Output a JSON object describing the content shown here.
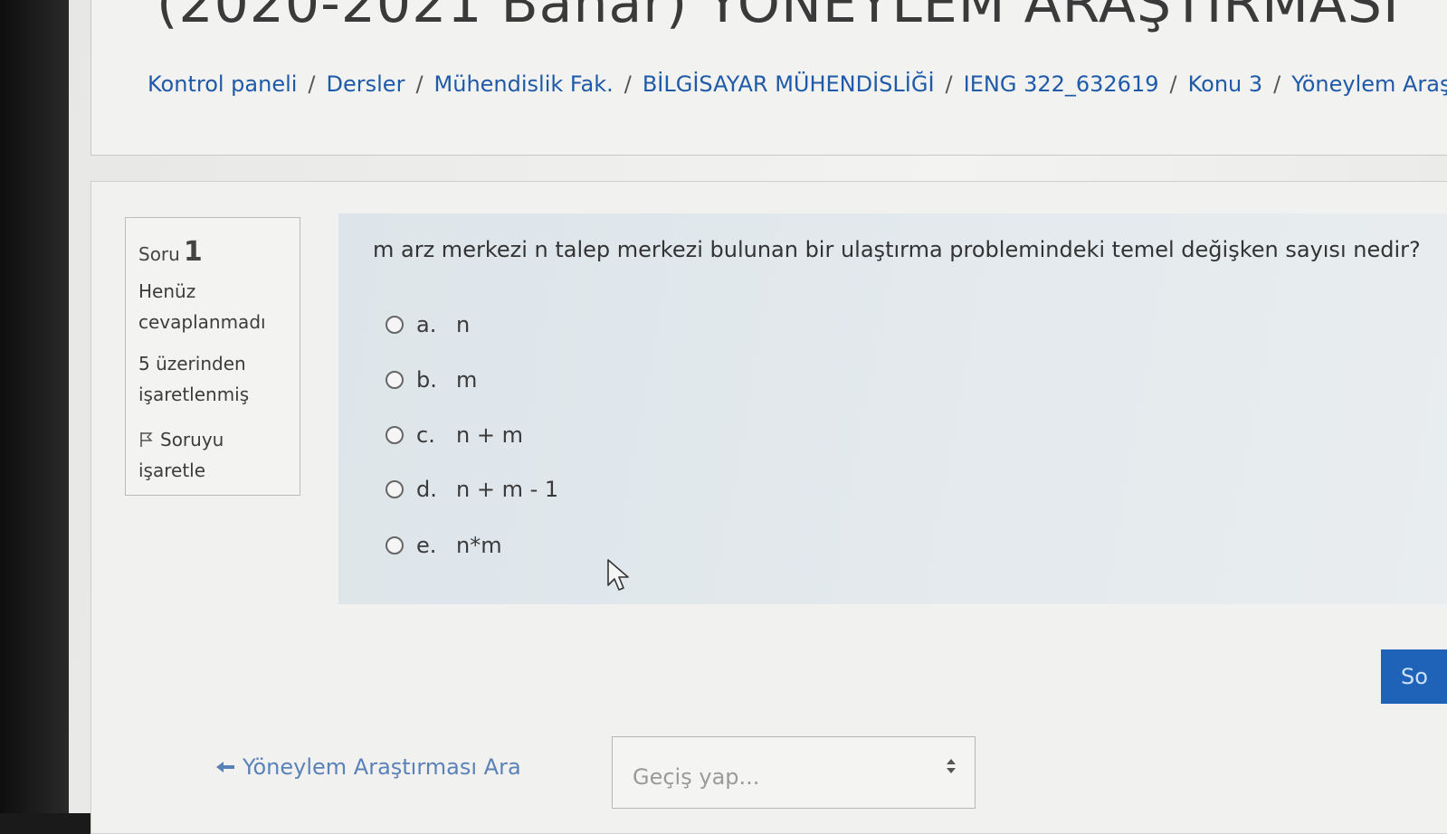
{
  "header": {
    "title": "(2020-2021 Bahar) YÖNEYLEM ARAŞTIRMASI",
    "breadcrumb": [
      "Kontrol paneli",
      "Dersler",
      "Mühendislik Fak.",
      "BİLGİSAYAR MÜHENDİSLİĞİ",
      "IENG 322_632619",
      "Konu 3",
      "Yöneylem Araş"
    ],
    "separator": "/"
  },
  "question_info": {
    "label": "Soru",
    "number": "1",
    "status_line1": "Henüz",
    "status_line2": "cevaplanmadı",
    "marks_line1": "5 üzerinden",
    "marks_line2": "işaretlenmiş",
    "flag_line1": "Soruyu",
    "flag_line2": "işaretle"
  },
  "question": {
    "text": "m arz merkezi n talep merkezi bulunan bir ulaştırma problemindeki temel değişken sayısı nedir?",
    "options": [
      {
        "letter": "a.",
        "text": "n"
      },
      {
        "letter": "b.",
        "text": "m"
      },
      {
        "letter": "c.",
        "text": "n + m"
      },
      {
        "letter": "d.",
        "text": "n + m - 1"
      },
      {
        "letter": "e.",
        "text": "n*m"
      }
    ]
  },
  "navigation": {
    "next_button_label": "So",
    "back_link": "Yöneylem Araştırması Ara",
    "jump_placeholder": "Geçiş yap..."
  },
  "colors": {
    "link": "#1f5aa8",
    "button": "#1e63b8",
    "question_bg": "#e3e9ed"
  }
}
